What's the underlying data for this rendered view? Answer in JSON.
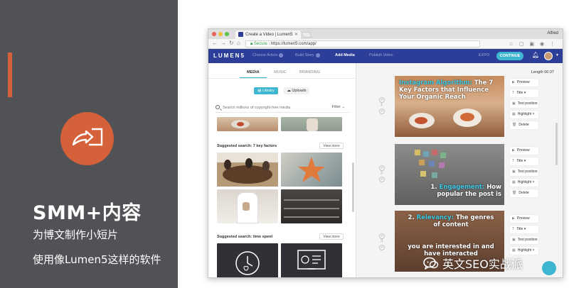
{
  "slide": {
    "title": "SMM+内容",
    "subtitle_1": "为博文制作小短片",
    "subtitle_2": "使用像Lumen5这样的软件",
    "accent_color": "#d4613a",
    "icon": "video-share-icon"
  },
  "browser": {
    "tab_title": "Create a Video | Lumen5",
    "user": "Alfred",
    "url_secure": "Secure",
    "url": "https://lumen5.com/app/"
  },
  "app": {
    "brand": "LUMEN5",
    "steps": [
      "Choose Article",
      "Build Story",
      "Add Media",
      "Publish Video"
    ],
    "active_step": "Add Media",
    "exit": "EXPO",
    "continue": "CONTINUE"
  },
  "media": {
    "tabs": [
      "MEDIA",
      "MUSIC",
      "BRANDING"
    ],
    "active_tab": "MEDIA",
    "library_btn": "Library",
    "uploads_btn": "Uploads",
    "search_placeholder": "Search millions of copyright-free media",
    "filter_label": "Filter",
    "suggestions": [
      {
        "label": "Suggested search: 7 key factors",
        "view_more": "View more"
      },
      {
        "label": "Suggested search: time spent",
        "view_more": "View more"
      }
    ]
  },
  "story": {
    "length_label": "Length 00:37",
    "scenes": [
      {
        "number": "1",
        "text_highlight": "Instagram Algorithm:",
        "text_rest": "The 7 Key Factors that Influence Your Organic Reach"
      },
      {
        "number": "2",
        "text_prefix": "1.",
        "text_highlight": "Engagement:",
        "text_rest": "How popular the post is"
      },
      {
        "number": "3",
        "text_prefix": "2.",
        "text_highlight": "Relevancy:",
        "text_rest": "The genres of content",
        "text_extra": "you are interested in and have interacted"
      }
    ],
    "controls": {
      "preview": "Preview",
      "title": "Title",
      "text_position": "Text position",
      "highlight": "Highlight",
      "delete": "Delete"
    }
  },
  "watermark": {
    "text": "英文SEO实战派"
  }
}
